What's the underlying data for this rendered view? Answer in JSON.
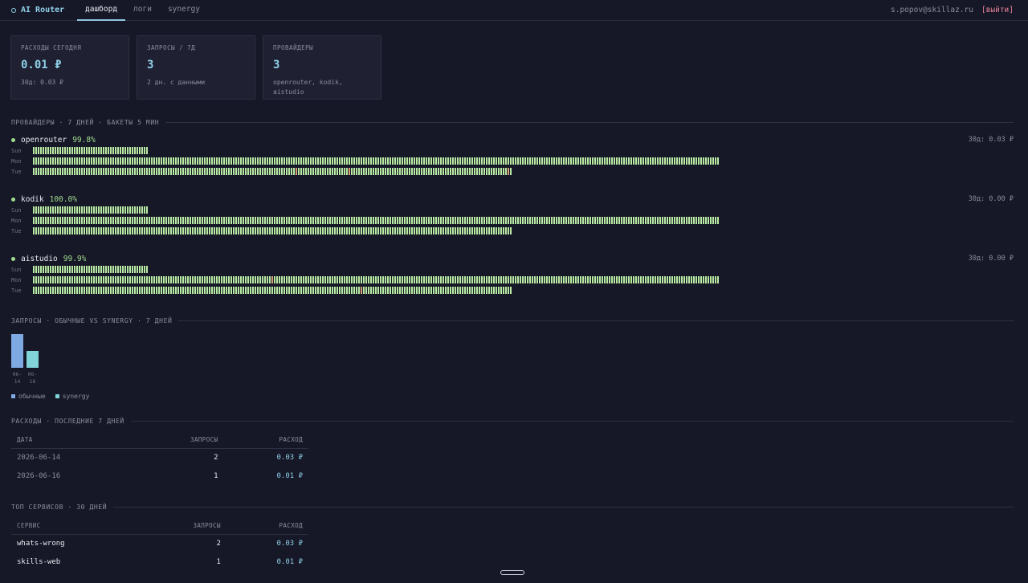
{
  "header": {
    "brand": "AI Router",
    "tabs": [
      "дашборд",
      "логи",
      "synergy"
    ],
    "active_tab": 0,
    "user_email": "s.popov@skillaz.ru",
    "logout_label": "[выйти]"
  },
  "cards": [
    {
      "label": "РАСХОДЫ СЕГОДНЯ",
      "value": "0.01 ₽",
      "sub": "30д: 0.03 ₽"
    },
    {
      "label": "ЗАПРОСЫ / 7Д",
      "value": "3",
      "sub": "2 дн. с данными"
    },
    {
      "label": "ПРОВАЙДЕРЫ",
      "value": "3",
      "sub": "openrouter, kodik, aistudio"
    }
  ],
  "providers_section": {
    "title": "ПРОВАЙДЕРЫ · 7 ДНЕЙ · БАКЕТЫ 5 МИН"
  },
  "providers": [
    {
      "name": "openrouter",
      "uptime": "99.8%",
      "cost": "30д: 0.03 ₽",
      "days": [
        {
          "label": "Sun",
          "ticks": 48,
          "warn": []
        },
        {
          "label": "Mon",
          "ticks": 285,
          "warn": []
        },
        {
          "label": "Tue",
          "ticks": 199,
          "warn": [
            109,
            131,
            197
          ]
        }
      ]
    },
    {
      "name": "kodik",
      "uptime": "100.0%",
      "cost": "30д: 0.00 ₽",
      "days": [
        {
          "label": "Sun",
          "ticks": 48,
          "warn": []
        },
        {
          "label": "Mon",
          "ticks": 285,
          "warn": []
        },
        {
          "label": "Tue",
          "ticks": 199,
          "warn": []
        }
      ]
    },
    {
      "name": "aistudio",
      "uptime": "99.9%",
      "cost": "30д: 0.00 ₽",
      "days": [
        {
          "label": "Sun",
          "ticks": 48,
          "warn": []
        },
        {
          "label": "Mon",
          "ticks": 285,
          "warn": [
            99
          ]
        },
        {
          "label": "Tue",
          "ticks": 199,
          "warn": [
            136
          ]
        }
      ]
    }
  ],
  "requests_section": {
    "title": "ЗАПРОСЫ · ОБЫЧНЫЕ VS SYNERGY · 7 ДНЕЙ"
  },
  "chart_data": {
    "type": "bar",
    "categories": [
      "06-14",
      "06-16"
    ],
    "series": [
      {
        "name": "обычные",
        "values": [
          2,
          0
        ]
      },
      {
        "name": "synergy",
        "values": [
          0,
          1
        ]
      }
    ],
    "ylim": [
      0,
      2
    ],
    "colors": {
      "обычные": "#7fa9e3",
      "synergy": "#7fd3d9"
    },
    "legend": "bottom-left"
  },
  "costs_section": {
    "title": "РАСХОДЫ · ПОСЛЕДНИЕ 7 ДНЕЙ"
  },
  "costs_table": {
    "headers": [
      "ДАТА",
      "ЗАПРОСЫ",
      "РАСХОД"
    ],
    "rows": [
      {
        "date": "2026-06-14",
        "requests": "2",
        "cost": "0.03 ₽"
      },
      {
        "date": "2026-06-16",
        "requests": "1",
        "cost": "0.01 ₽"
      }
    ]
  },
  "services_section": {
    "title": "ТОП СЕРВИСОВ · 30 ДНЕЙ"
  },
  "services_table": {
    "headers": [
      "СЕРВИС",
      "ЗАПРОСЫ",
      "РАСХОД"
    ],
    "rows": [
      {
        "service": "whats-wrong",
        "requests": "2",
        "cost": "0.03 ₽"
      },
      {
        "service": "skills-web",
        "requests": "1",
        "cost": "0.01 ₽"
      }
    ]
  }
}
